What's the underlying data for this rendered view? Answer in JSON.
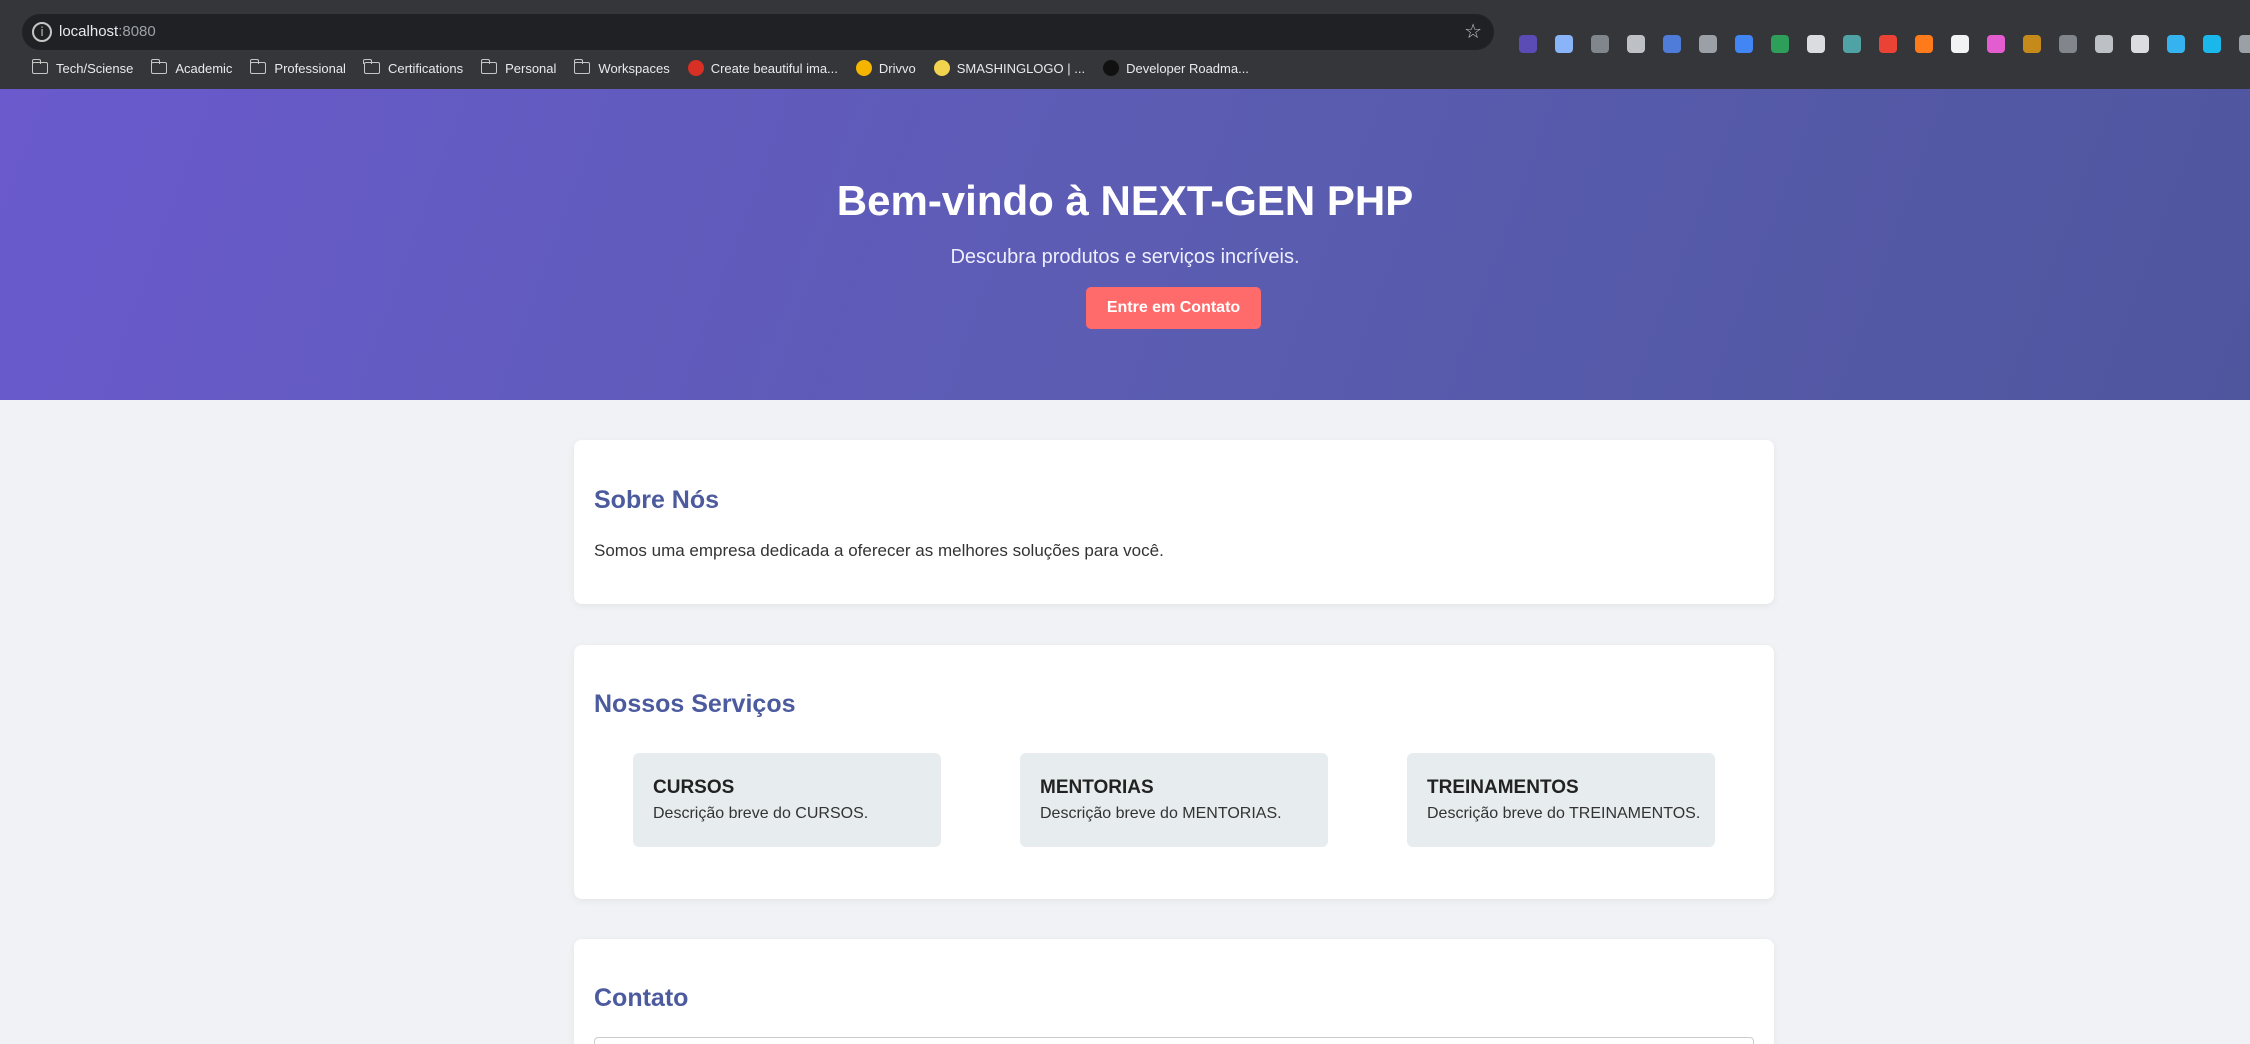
{
  "browser": {
    "url_host": "localhost",
    "url_port": ":8080",
    "extensions": [
      {
        "name": "ext-badge-icon",
        "color": "#5b4bb5"
      },
      {
        "name": "ext-robot-icon",
        "color": "#8ab4f8"
      },
      {
        "name": "ext-layout-icon",
        "color": "#80868b"
      },
      {
        "name": "ext-camera-icon",
        "color": "#bdc1c6"
      },
      {
        "name": "ext-counter-icon",
        "color": "#4f7bd9"
      },
      {
        "name": "ext-cmd-icon",
        "color": "#9aa0a6"
      },
      {
        "name": "ext-translate-icon",
        "color": "#4285f4"
      },
      {
        "name": "ext-js-icon",
        "color": "#2e9e5b"
      },
      {
        "name": "ext-react-icon",
        "color": "#dadce0"
      },
      {
        "name": "ext-cookie-icon",
        "color": "#4fa3a5"
      },
      {
        "name": "ext-store-icon",
        "color": "#ea4335"
      },
      {
        "name": "ext-flame-icon",
        "color": "#ff7a1a"
      },
      {
        "name": "ext-circle-icon",
        "color": "#f1f3f4"
      },
      {
        "name": "ext-wave-icon",
        "color": "#e35dd1"
      },
      {
        "name": "ext-bird-icon",
        "color": "#c58a1a"
      },
      {
        "name": "ext-gear-icon",
        "color": "#80868b"
      },
      {
        "name": "ext-vue-icon",
        "color": "#bdc1c6"
      },
      {
        "name": "ext-target-icon",
        "color": "#dadce0"
      },
      {
        "name": "ext-heart-icon",
        "color": "#35b2f0"
      },
      {
        "name": "ext-vimeo-icon",
        "color": "#1ab7ea"
      },
      {
        "name": "ext-panel-icon",
        "color": "#9aa0a6"
      }
    ],
    "bookmarks": [
      {
        "label": "Tech/Sciense",
        "type": "folder"
      },
      {
        "label": "Academic",
        "type": "folder"
      },
      {
        "label": "Professional",
        "type": "folder"
      },
      {
        "label": "Certifications",
        "type": "folder"
      },
      {
        "label": "Personal",
        "type": "folder"
      },
      {
        "label": "Workspaces",
        "type": "folder"
      },
      {
        "label": "Create beautiful ima...",
        "type": "link",
        "color": "#d93025"
      },
      {
        "label": "Drivvo",
        "type": "link",
        "color": "#f5b400"
      },
      {
        "label": "SMASHINGLOGO | ...",
        "type": "link",
        "color": "#f2d34f"
      },
      {
        "label": "Developer Roadma...",
        "type": "link",
        "color": "#111111"
      }
    ]
  },
  "hero": {
    "title": "Bem-vindo à NEXT-GEN PHP",
    "subtitle": "Descubra produtos e serviços incríveis.",
    "cta_label": "Entre em Contato"
  },
  "about": {
    "title": "Sobre Nós",
    "text": "Somos uma empresa dedicada a oferecer as melhores soluções para você."
  },
  "services": {
    "title": "Nossos Serviços",
    "items": [
      {
        "name": "CURSOS",
        "desc": "Descrição breve do CURSOS."
      },
      {
        "name": "MENTORIAS",
        "desc": "Descrição breve do MENTORIAS."
      },
      {
        "name": "TREINAMENTOS",
        "desc": "Descrição breve do TREINAMENTOS."
      }
    ]
  },
  "contact": {
    "title": "Contato"
  },
  "colors": {
    "accent": "#ff6b6b",
    "heading": "#4c5a9e",
    "hero_start": "#6a5acd",
    "hero_end": "#4f569e"
  }
}
